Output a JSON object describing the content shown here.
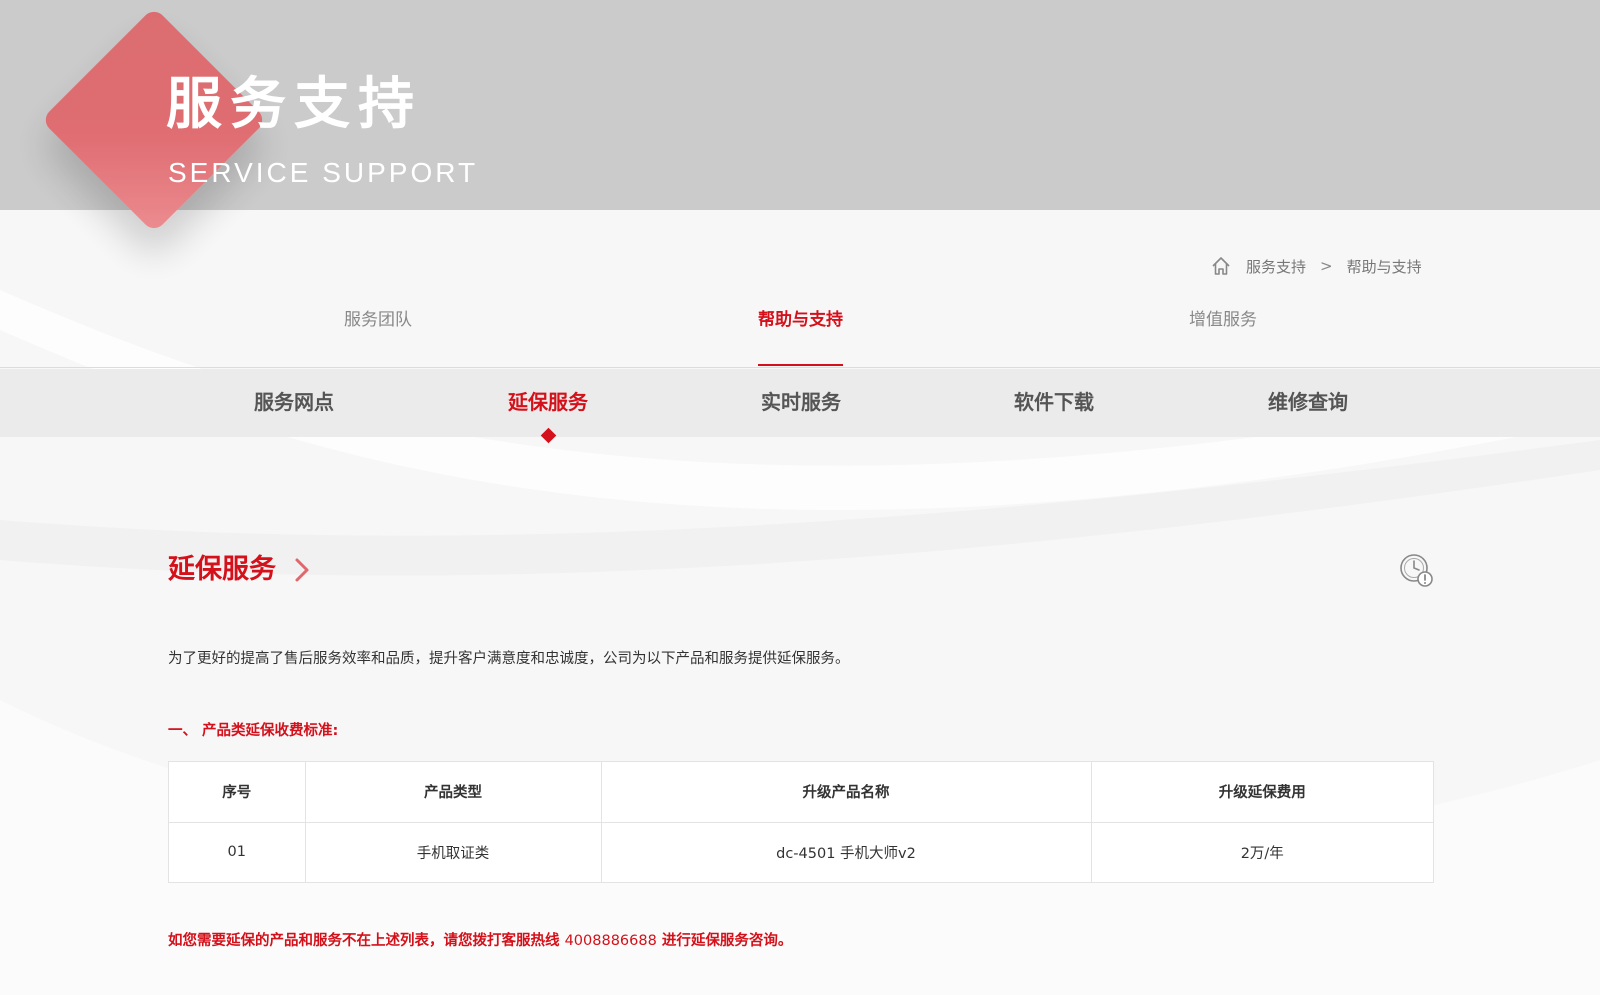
{
  "banner": {
    "title": "服务支持",
    "subtitle": "SERVICE SUPPORT"
  },
  "breadcrumb": {
    "items": [
      "服务支持",
      "帮助与支持"
    ],
    "separator": ">"
  },
  "top_tabs": [
    {
      "label": "服务团队",
      "active": false
    },
    {
      "label": "帮助与支持",
      "active": true
    },
    {
      "label": "增值服务",
      "active": false
    }
  ],
  "sub_nav": [
    {
      "label": "服务网点",
      "active": false
    },
    {
      "label": "延保服务",
      "active": true
    },
    {
      "label": "实时服务",
      "active": false
    },
    {
      "label": "软件下载",
      "active": false
    },
    {
      "label": "维修查询",
      "active": false
    }
  ],
  "content": {
    "section_title": "延保服务",
    "intro": "为了更好的提高了售后服务效率和品质，提升客户满意度和忠诚度，公司为以下产品和服务提供延保服务。",
    "sub_heading": "一、 产品类延保收费标准:",
    "table": {
      "headers": [
        "序号",
        "产品类型",
        "升级产品名称",
        "升级延保费用"
      ],
      "rows": [
        [
          "01",
          "手机取证类",
          "dc-4501 手机大师v2",
          "2万/年"
        ]
      ]
    },
    "footer_note_before": "如您需要延保的产品和服务不在上述列表，请您拨打客服热线",
    "footer_phone": "4008886688",
    "footer_note_after": "进行延保服务咨询。"
  },
  "colors": {
    "accent": "#d4111a",
    "banner_bg": "#cbcbcb",
    "diamond": "#e06a6f"
  },
  "icons": {
    "breadcrumb_home": "home-icon",
    "section_chevron": "chevron-right-icon",
    "corner": "clock-icon"
  }
}
